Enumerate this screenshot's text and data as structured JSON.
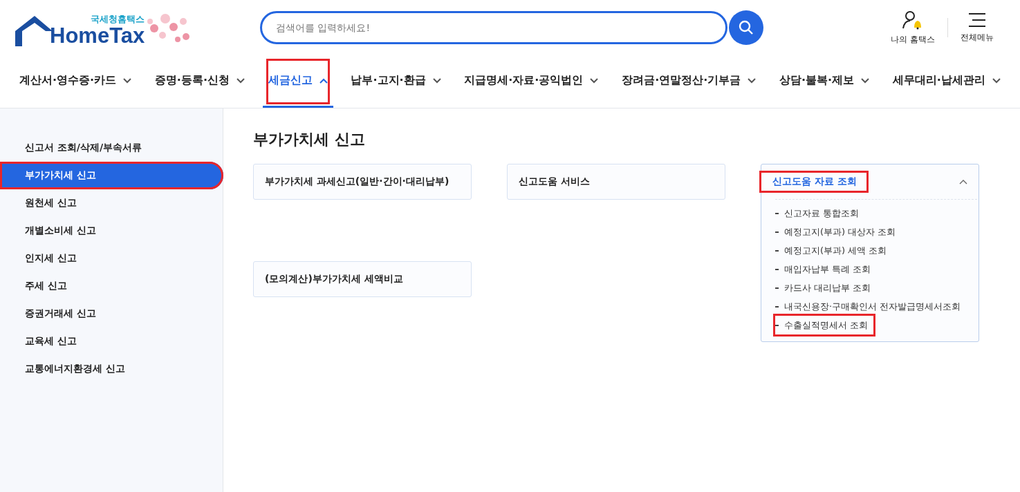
{
  "logo": {
    "subtitle": "국세청홈택스",
    "title": "HomeTax"
  },
  "search": {
    "placeholder": "검색어를 입력하세요!"
  },
  "utility": [
    {
      "kind": "my",
      "label": "나의 홈택스"
    },
    {
      "kind": "menu",
      "label": "전체메뉴"
    }
  ],
  "nav": [
    {
      "label": "계산서·영수증·카드",
      "selected": false,
      "annotated": false
    },
    {
      "label": "증명·등록·신청",
      "selected": false,
      "annotated": false
    },
    {
      "label": "세금신고",
      "selected": true,
      "annotated": true
    },
    {
      "label": "납부·고지·환급",
      "selected": false,
      "annotated": false
    },
    {
      "label": "지급명세·자료·공익법인",
      "selected": false,
      "annotated": false
    },
    {
      "label": "장려금·연말정산·기부금",
      "selected": false,
      "annotated": false
    },
    {
      "label": "상담·불복·제보",
      "selected": false,
      "annotated": false
    },
    {
      "label": "세무대리·납세관리",
      "selected": false,
      "annotated": false
    }
  ],
  "sidebar": {
    "items": [
      {
        "label": "신고서 조회/삭제/부속서류",
        "selected": false,
        "annotated": false
      },
      {
        "label": "부가가치세 신고",
        "selected": true,
        "annotated": true
      },
      {
        "label": "원천세 신고",
        "selected": false,
        "annotated": false
      },
      {
        "label": "개별소비세 신고",
        "selected": false,
        "annotated": false
      },
      {
        "label": "인지세 신고",
        "selected": false,
        "annotated": false
      },
      {
        "label": "주세 신고",
        "selected": false,
        "annotated": false
      },
      {
        "label": "증권거래세 신고",
        "selected": false,
        "annotated": false
      },
      {
        "label": "교육세 신고",
        "selected": false,
        "annotated": false
      },
      {
        "label": "교통에너지환경세 신고",
        "selected": false,
        "annotated": false
      }
    ]
  },
  "content": {
    "title": "부가가치세 신고",
    "cards": [
      {
        "kind": "link",
        "label": "부가가치세 과세신고(일반·간이·대리납부)"
      },
      {
        "kind": "link",
        "label": "신고도움 서비스"
      },
      {
        "kind": "accordion",
        "label": "신고도움 자료 조회",
        "expanded": true,
        "annotated": true,
        "children": [
          {
            "label": "신고자료 통합조회",
            "annotated": false
          },
          {
            "label": "예정고지(부과) 대상자 조회",
            "annotated": false
          },
          {
            "label": "예정고지(부과) 세액 조회",
            "annotated": false
          },
          {
            "label": "매입자납부 특례 조회",
            "annotated": false
          },
          {
            "label": "카드사 대리납부 조회",
            "annotated": false
          },
          {
            "label": "내국신용장·구매확인서 전자발급명세서조회",
            "annotated": false
          },
          {
            "label": "수출실적명세서 조회",
            "annotated": true
          }
        ]
      },
      {
        "kind": "link",
        "label": "(모의계산)부가가치세 세액비교"
      }
    ]
  }
}
